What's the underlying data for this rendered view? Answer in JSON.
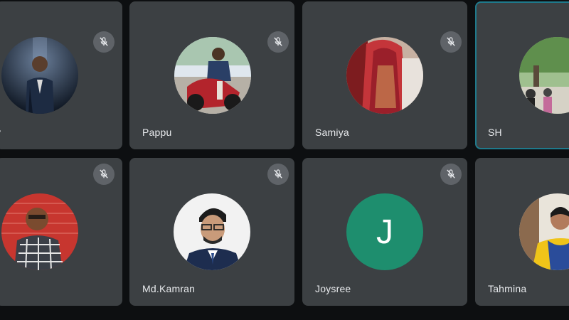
{
  "colors": {
    "background": "#0d0f11",
    "tile": "#3c4043",
    "name_text": "#e8eaed",
    "active_speaker_border": "#1f7a8c",
    "letter_avatar": "#1e8e6e",
    "mute_badge": "#5f6368"
  },
  "participants": [
    {
      "name": "y",
      "muted": true,
      "avatar": "photo"
    },
    {
      "name": "Pappu",
      "muted": true,
      "avatar": "photo"
    },
    {
      "name": "Samiya",
      "muted": true,
      "avatar": "photo"
    },
    {
      "name": "SH",
      "muted": false,
      "avatar": "photo",
      "speaking": true
    },
    {
      "name": "",
      "muted": true,
      "avatar": "photo"
    },
    {
      "name": "Md.Kamran",
      "muted": true,
      "avatar": "photo"
    },
    {
      "name": "Joysree",
      "muted": true,
      "avatar": "letter",
      "initial": "J"
    },
    {
      "name": "Tahmina",
      "muted": false,
      "avatar": "photo"
    }
  ],
  "icons": {
    "mute": "mic-off-icon"
  }
}
